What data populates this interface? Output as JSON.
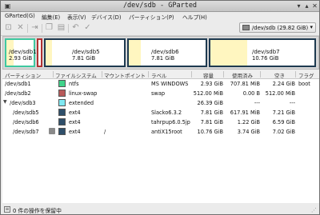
{
  "window": {
    "title": "/dev/sdb - GParted",
    "minimize_glyph": "▾",
    "maximize_glyph": "▴",
    "close_glyph": "✕"
  },
  "menu": [
    "GParted(G)",
    "編集(E)",
    "表示(V)",
    "デバイス(D)",
    "パーティション(P)",
    "ヘルプ(H)"
  ],
  "toolbar": {
    "icons": [
      "new-icon",
      "delete-icon",
      "resize-icon",
      "copy-icon",
      "paste-icon",
      "undo-icon",
      "apply-icon"
    ],
    "device": {
      "label": "/dev/sdb",
      "size": "(29.82 GiB)"
    }
  },
  "disk_map": [
    {
      "name": "/dev/sdb1",
      "size": "2.93 GiB",
      "border": "#3ec8a0",
      "used_fraction": 0.27
    },
    {
      "name": "",
      "size": "",
      "border": "#b03030",
      "used_fraction": 0
    },
    {
      "name": "/dev/sdb5",
      "size": "7.81 GiB",
      "border": "#1e3a50",
      "used_fraction": 0.08
    },
    {
      "name": "/dev/sdb6",
      "size": "7.81 GiB",
      "border": "#1e3a50",
      "used_fraction": 0.16
    },
    {
      "name": "/dev/sdb7",
      "size": "10.76 GiB",
      "border": "#1e3a50",
      "used_fraction": 0.35
    }
  ],
  "columns": [
    "パーティション",
    "ファイルシステム",
    "マウントポイント",
    "ラベル",
    "容量",
    "使用済み",
    "空き",
    "フラグ"
  ],
  "rows": [
    {
      "partition": "/dev/sdb1",
      "fs": "ntfs",
      "color": "#3fd38a",
      "mount": "",
      "label": "MS WINDOWS",
      "size": "2.93 GiB",
      "used": "707.81 MiB",
      "free": "2.24 GiB",
      "flags": "boot",
      "indent": 0,
      "locked": false
    },
    {
      "partition": "/dev/sdb2",
      "fs": "linux-swap",
      "color": "#b85a5a",
      "mount": "",
      "label": "swap",
      "size": "512.00 MiB",
      "used": "0.00 B",
      "free": "512.00 MiB",
      "flags": "",
      "indent": 0,
      "locked": false
    },
    {
      "partition": "/dev/sdb3",
      "fs": "extended",
      "color": "#7fe8f2",
      "mount": "",
      "label": "",
      "size": "26.39 GiB",
      "used": "---",
      "free": "---",
      "flags": "",
      "indent": 0,
      "locked": false,
      "expanded": true
    },
    {
      "partition": "/dev/sdb5",
      "fs": "ext4",
      "color": "#2f4f6a",
      "mount": "",
      "label": "Slacko6.3.2",
      "size": "7.81 GiB",
      "used": "617.91 MiB",
      "free": "7.21 GiB",
      "flags": "",
      "indent": 1,
      "locked": false
    },
    {
      "partition": "/dev/sdb6",
      "fs": "ext4",
      "color": "#2f4f6a",
      "mount": "",
      "label": "tahrpup6.0.5jp",
      "size": "7.81 GiB",
      "used": "1.22 GiB",
      "free": "6.59 GiB",
      "flags": "",
      "indent": 1,
      "locked": false
    },
    {
      "partition": "/dev/sdb7",
      "fs": "ext4",
      "color": "#2f4f6a",
      "mount": "/",
      "label": "antiX15root",
      "size": "10.76 GiB",
      "used": "3.74 GiB",
      "free": "7.02 GiB",
      "flags": "",
      "indent": 1,
      "locked": true
    }
  ],
  "status": {
    "text": "0 件の操作を保留中"
  }
}
